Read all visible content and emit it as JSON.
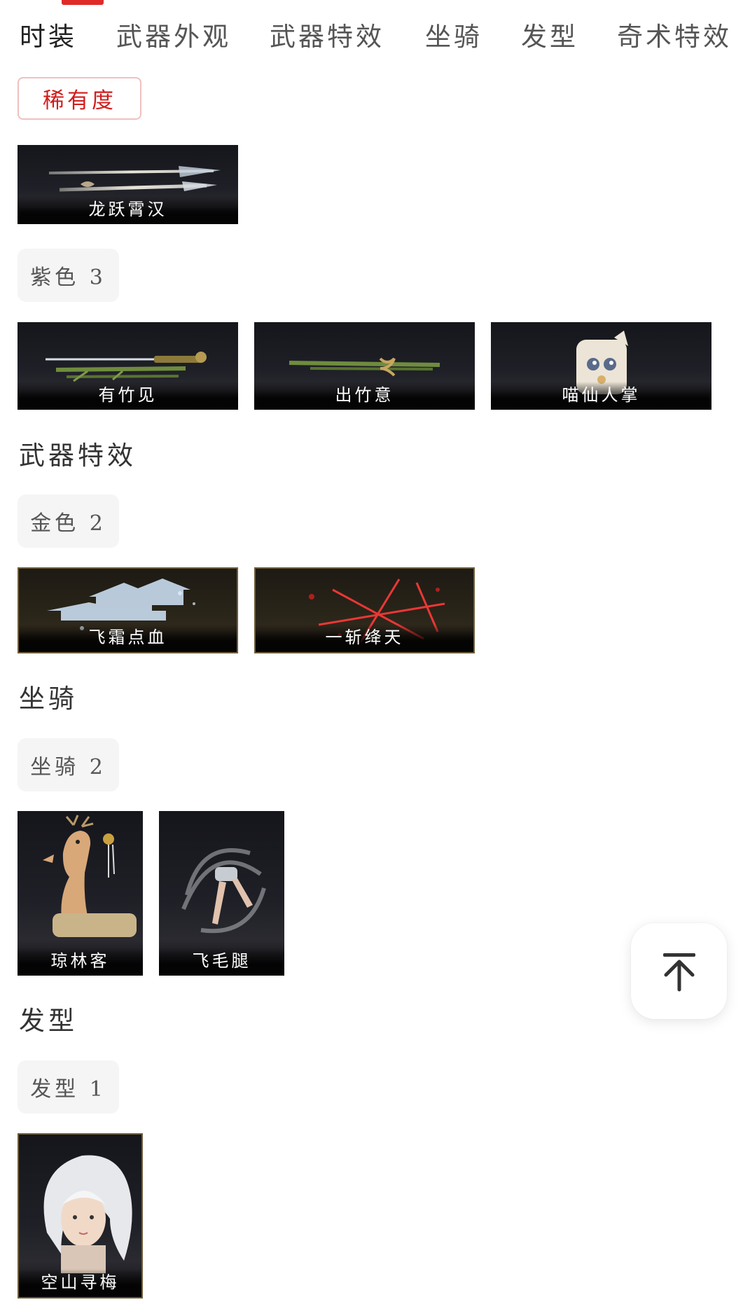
{
  "tabs": [
    {
      "label": "时装"
    },
    {
      "label": "武器外观"
    },
    {
      "label": "武器特效"
    },
    {
      "label": "坐骑"
    },
    {
      "label": "发型"
    },
    {
      "label": "奇术特效"
    }
  ],
  "rarity_button": "稀有度",
  "weapon_skin": {
    "featured": [
      {
        "name": "龙跃霄汉",
        "icon": "dual-spear-icon"
      }
    ],
    "purple_chip": "紫色 3",
    "purple_items": [
      {
        "name": "有竹见",
        "icon": "bamboo-sword-icon"
      },
      {
        "name": "出竹意",
        "icon": "bamboo-staff-icon"
      },
      {
        "name": "喵仙人掌",
        "icon": "cat-fist-icon"
      }
    ]
  },
  "weapon_effects": {
    "title": "武器特效",
    "chip": "金色 2",
    "items": [
      {
        "name": "飞霜点血",
        "icon": "ice-palace-icon"
      },
      {
        "name": "一斩绛天",
        "icon": "red-slash-icon"
      }
    ]
  },
  "mounts": {
    "title": "坐骑",
    "chip": "坐骑 2",
    "items": [
      {
        "name": "琼林客",
        "icon": "deer-mount-icon"
      },
      {
        "name": "飞毛腿",
        "icon": "spinning-legs-icon"
      }
    ]
  },
  "hairstyles": {
    "title": "发型",
    "chip": "发型 1",
    "items": [
      {
        "name": "空山寻梅",
        "icon": "white-hair-portrait-icon"
      }
    ]
  },
  "colors": {
    "accent_red": "#e02a2a",
    "rarity_text": "#d11c1c",
    "gold_border": "#6e5d3a"
  },
  "back_to_top_icon": "arrow-up-to-top-icon"
}
